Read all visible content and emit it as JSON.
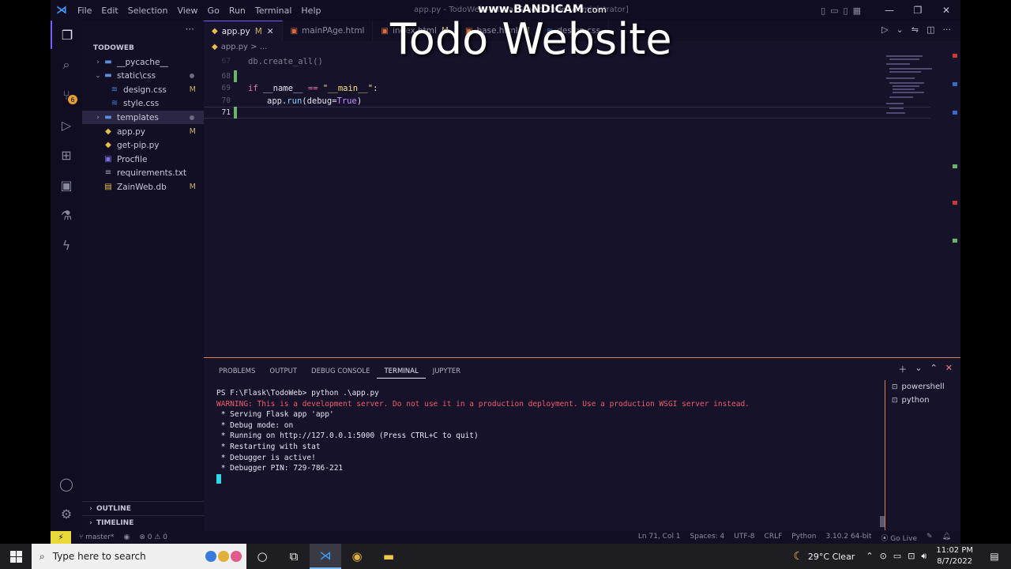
{
  "watermark": {
    "brand": "www.BANDICAM",
    "suffix": ".com",
    "video_title": "Todo Website"
  },
  "window": {
    "title": "app.py - TodoWeb - Visual Studio Code [Administrator]"
  },
  "menu": [
    "File",
    "Edit",
    "Selection",
    "View",
    "Go",
    "Run",
    "Terminal",
    "Help"
  ],
  "activity": {
    "scm_badge": "6"
  },
  "explorer": {
    "more": "···",
    "root": "TODOWEB",
    "items": [
      {
        "label": "__pycache__",
        "status": ""
      },
      {
        "label": "static\\css",
        "status": ""
      },
      {
        "label": "design.css",
        "status": "M"
      },
      {
        "label": "style.css",
        "status": ""
      },
      {
        "label": "templates",
        "status": ""
      },
      {
        "label": "app.py",
        "status": "M"
      },
      {
        "label": "get-pip.py",
        "status": ""
      },
      {
        "label": "Procfile",
        "status": ""
      },
      {
        "label": "requirements.txt",
        "status": ""
      },
      {
        "label": "ZainWeb.db",
        "status": "M"
      }
    ],
    "outline": "OUTLINE",
    "timeline": "TIMELINE"
  },
  "tabs": [
    {
      "label": "app.py",
      "status": "M",
      "close": "✕"
    },
    {
      "label": "mainPAge.html",
      "status": ""
    },
    {
      "label": "index.html",
      "status": "M"
    },
    {
      "label": "base.html",
      "status": "M"
    },
    {
      "label": "design.css",
      "status": ""
    }
  ],
  "breadcrumb": "app.py > ...",
  "code": {
    "ln67": "67",
    "ln68": "68",
    "ln69": "69",
    "ln70": "70",
    "ln71": "71",
    "l67": "    db.create_all()",
    "l69_kw": "if",
    "l69_name": "__name__",
    "l69_op": "==",
    "l69_str": "\"__main__\"",
    "l69_colon": ":",
    "l70_obj": "app.",
    "l70_fn": "run",
    "l70_open": "(debug=",
    "l70_true": "True",
    "l70_close": ")"
  },
  "panel": {
    "tabs": [
      "PROBLEMS",
      "OUTPUT",
      "DEBUG CONSOLE",
      "TERMINAL",
      "JUPYTER"
    ],
    "active_tab": "TERMINAL",
    "terminal_lines": [
      "PS F:\\Flask\\TodoWeb> python .\\app.py",
      "WARNING: This is a development server. Do not use it in a production deployment. Use a production WSGI server instead.",
      " * Serving Flask app 'app'",
      " * Debug mode: on",
      " * Running on http://127.0.0.1:5000 (Press CTRL+C to quit)",
      " * Restarting with stat",
      " * Debugger is active!",
      " * Debugger PIN: 729-786-221"
    ],
    "terminals": [
      "powershell",
      "python"
    ]
  },
  "status": {
    "branch": "master*",
    "problems": "⊗ 0 ⚠ 0",
    "position": "Ln 71, Col 1",
    "spaces": "Spaces: 4",
    "encoding": "UTF-8",
    "eol": "CRLF",
    "language": "Python",
    "interpreter": "3.10.2 64-bit",
    "golive": "Go Live"
  },
  "taskbar": {
    "search_placeholder": "Type here to search",
    "weather": "29°C  Clear",
    "time": "11:02 PM",
    "date": "8/7/2022"
  },
  "colors": {
    "accent": "#7b5cff",
    "warning_text": "#ef5a6a",
    "panel_border": "#d67f4f"
  }
}
